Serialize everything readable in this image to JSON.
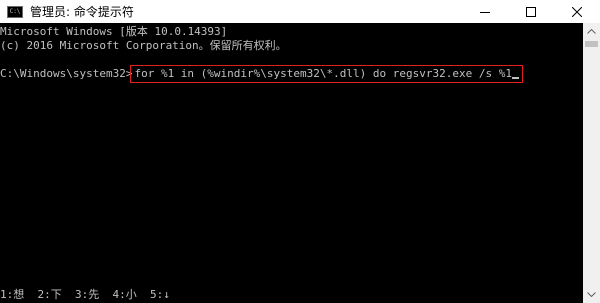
{
  "window": {
    "title": "管理员: 命令提示符",
    "icon": "cmd-icon",
    "icon_glyph": "C:\\",
    "controls": [
      "minimize",
      "maximize",
      "close"
    ]
  },
  "console": {
    "lines": [
      "Microsoft Windows [版本 10.0.14393]",
      "(c) 2016 Microsoft Corporation。保留所有权利。"
    ],
    "prompt": "C:\\Windows\\system32>",
    "command": "for %1 in (%windir%\\system32\\*.dll) do regsvr32.exe /s %1"
  },
  "ime_bar": "1:想  2:下  3:先  4:小  5:↓",
  "colors": {
    "background": "#000000",
    "text": "#c0c0c0",
    "highlight_box": "#e02020"
  }
}
